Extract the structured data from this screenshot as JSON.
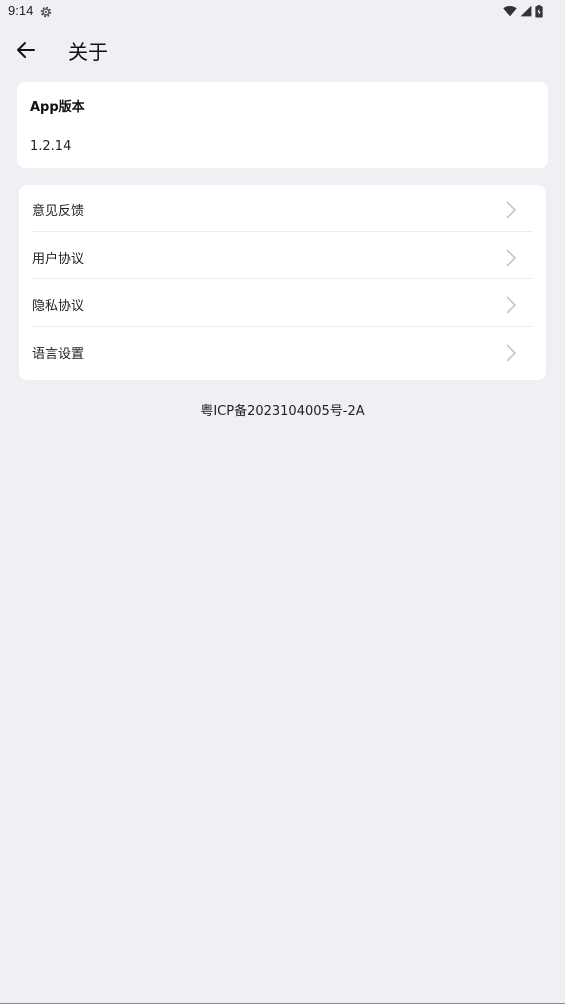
{
  "status_bar": {
    "time": "9:14"
  },
  "header": {
    "title": "关于"
  },
  "version": {
    "label": "App版本",
    "value": "1.2.14"
  },
  "menu": {
    "items": [
      {
        "label": "意见反馈"
      },
      {
        "label": "用户协议"
      },
      {
        "label": "隐私协议"
      },
      {
        "label": "语言设置"
      }
    ]
  },
  "footer": {
    "icp": "粤ICP备2023104005号-2A"
  }
}
